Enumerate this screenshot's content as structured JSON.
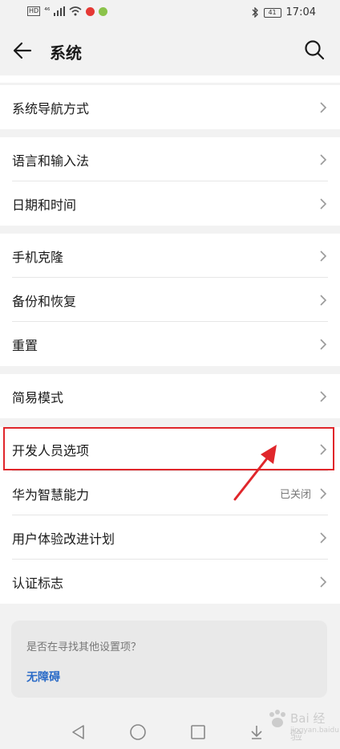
{
  "status_bar": {
    "hd": "HD",
    "signal": "⁴⁶",
    "time": "17:04",
    "battery": "41"
  },
  "header": {
    "title": "系统",
    "back_icon": "arrow-left-icon",
    "search_icon": "search-icon"
  },
  "groups": [
    {
      "items": [
        {
          "label": "系统导航方式"
        }
      ]
    },
    {
      "items": [
        {
          "label": "语言和输入法"
        },
        {
          "label": "日期和时间"
        }
      ]
    },
    {
      "items": [
        {
          "label": "手机克隆"
        },
        {
          "label": "备份和恢复"
        },
        {
          "label": "重置"
        }
      ]
    },
    {
      "items": [
        {
          "label": "简易模式"
        }
      ]
    },
    {
      "items": [
        {
          "label": "开发人员选项"
        },
        {
          "label": "华为智慧能力",
          "value": "已关闭"
        },
        {
          "label": "用户体验改进计划"
        },
        {
          "label": "认证标志"
        }
      ]
    }
  ],
  "suggestion_card": {
    "question": "是否在寻找其他设置项？",
    "link": "无障碍"
  },
  "colors": {
    "highlight": "#e0262b",
    "link": "#2b6bc7",
    "background": "#f2f2f2"
  },
  "watermark": {
    "text": "Bai 经验",
    "sub": "jingyan.baidu.com"
  }
}
